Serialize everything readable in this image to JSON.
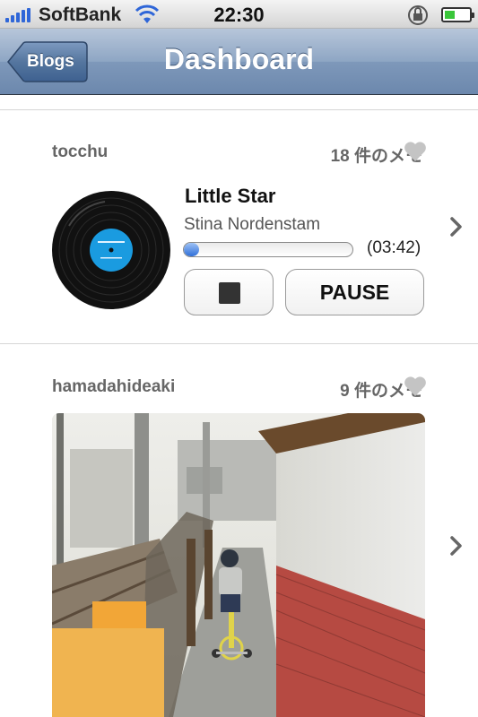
{
  "status_bar": {
    "carrier": "SoftBank",
    "time": "22:30",
    "icons": [
      "signal-icon",
      "wifi-icon",
      "rotation-lock-icon",
      "battery-icon"
    ]
  },
  "nav": {
    "back_label": "Blogs",
    "title": "Dashboard"
  },
  "posts": [
    {
      "user": "tocchu",
      "memo": "18 件のメモ",
      "type": "audio",
      "track": {
        "title": "Little Star",
        "artist": "Stina Nordenstam",
        "duration": "(03:42)",
        "progress": 0.09
      },
      "stop_icon": "stop-icon",
      "pause_label": "PAUSE"
    },
    {
      "user": "hamadahideaki",
      "memo": "9 件のメモ",
      "type": "photo",
      "photo_icon": "photo-of-child-on-bicycle"
    }
  ],
  "colors": {
    "nav_blue": "#7e98ba",
    "progress_blue": "#2f6fd8",
    "record_label": "#1a9be0",
    "heart": "#c4c4c4"
  }
}
